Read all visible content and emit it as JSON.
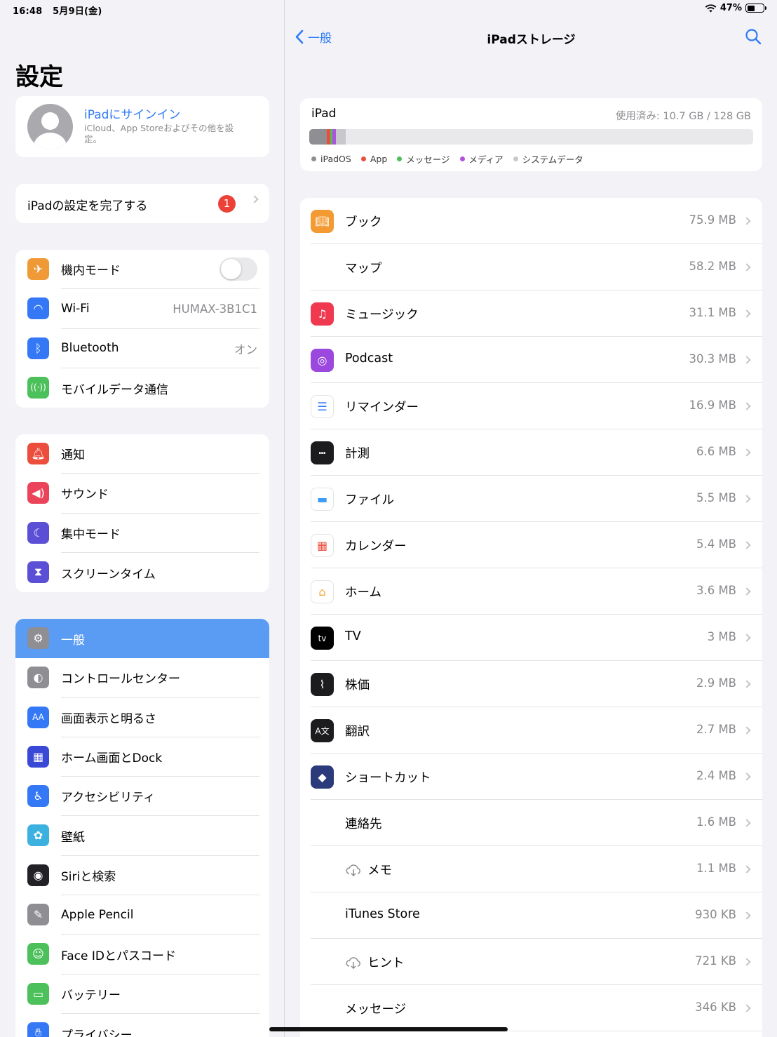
{
  "status": {
    "time": "16:48",
    "date": "5月9日(金)",
    "battery_percent": "47%",
    "battery_level": 0.47
  },
  "left": {
    "title": "設定",
    "profile": {
      "title": "iPadにサインイン",
      "subtitle": "iCloud、App Storeおよびその他を設定。"
    },
    "finish_setup": {
      "label": "iPadの設定を完了する",
      "badge": "1"
    },
    "group1": [
      {
        "label": "機内モード",
        "icon": "airplane-icon",
        "color": "#f09a37",
        "toggle": false
      },
      {
        "label": "Wi-Fi",
        "icon": "wifi-icon",
        "color": "#3478f6",
        "value": "HUMAX-3B1C1"
      },
      {
        "label": "Bluetooth",
        "icon": "bluetooth-icon",
        "color": "#3478f6",
        "value": "オン"
      },
      {
        "label": "モバイルデータ通信",
        "icon": "cellular-icon",
        "color": "#4cc05a"
      }
    ],
    "group2": [
      {
        "label": "通知",
        "icon": "bell-icon",
        "color": "#eb4e3d"
      },
      {
        "label": "サウンド",
        "icon": "speaker-icon",
        "color": "#eb445a"
      },
      {
        "label": "集中モード",
        "icon": "moon-icon",
        "color": "#5b4fd6"
      },
      {
        "label": "スクリーンタイム",
        "icon": "hourglass-icon",
        "color": "#5b4fd6"
      }
    ],
    "group3": [
      {
        "label": "一般",
        "icon": "gear-icon",
        "color": "#8e8e93",
        "selected": true
      },
      {
        "label": "コントロールセンター",
        "icon": "toggles-icon",
        "color": "#8e8e93"
      },
      {
        "label": "画面表示と明るさ",
        "icon": "text-size-icon",
        "color": "#3478f6"
      },
      {
        "label": "ホーム画面とDock",
        "icon": "grid-icon",
        "color": "#3a48d6"
      },
      {
        "label": "アクセシビリティ",
        "icon": "accessibility-icon",
        "color": "#3478f6"
      },
      {
        "label": "壁紙",
        "icon": "flower-icon",
        "color": "#3cb1e0"
      },
      {
        "label": "Siriと検索",
        "icon": "siri-icon",
        "color": "#222226"
      },
      {
        "label": "Apple Pencil",
        "icon": "pencil-icon",
        "color": "#8e8e93"
      },
      {
        "label": "Face IDとパスコード",
        "icon": "faceid-icon",
        "color": "#4cc05a"
      },
      {
        "label": "バッテリー",
        "icon": "battery-icon",
        "color": "#4cc05a"
      },
      {
        "label": "プライバシー",
        "icon": "hand-icon",
        "color": "#3478f6"
      }
    ]
  },
  "right": {
    "back_label": "一般",
    "title": "iPadストレージ",
    "storage": {
      "device": "iPad",
      "used": "使用済み: 10.7 GB / 128 GB",
      "segments": [
        {
          "name": "iPadOS",
          "color": "#8e8e93",
          "fraction": 0.04
        },
        {
          "name": "App",
          "color": "#eb4e3d",
          "fraction": 0.008
        },
        {
          "name": "メッセージ",
          "color": "#4cc05a",
          "fraction": 0.004
        },
        {
          "name": "メディア",
          "color": "#af52de",
          "fraction": 0.008
        },
        {
          "name": "システムデータ",
          "color": "#c7c7cc",
          "fraction": 0.022
        }
      ]
    },
    "apps": [
      {
        "name": "ブック",
        "size": "75.9 MB",
        "icon": "books-icon",
        "color": "#f39a32"
      },
      {
        "name": "マップ",
        "size": "58.2 MB",
        "icon": ""
      },
      {
        "name": "ミュージック",
        "size": "31.1 MB",
        "icon": "music-icon",
        "color": "#f0384f"
      },
      {
        "name": "Podcast",
        "size": "30.3 MB",
        "icon": "podcast-icon",
        "color": "#9a48dd"
      },
      {
        "name": "リマインダー",
        "size": "16.9 MB",
        "icon": "reminders-icon",
        "color": "#ffffff"
      },
      {
        "name": "計測",
        "size": "6.6 MB",
        "icon": "measure-icon",
        "color": "#1c1c1e"
      },
      {
        "name": "ファイル",
        "size": "5.5 MB",
        "icon": "folder-icon",
        "color": "#ffffff"
      },
      {
        "name": "カレンダー",
        "size": "5.4 MB",
        "icon": "calendar-icon",
        "color": "#ffffff"
      },
      {
        "name": "ホーム",
        "size": "3.6 MB",
        "icon": "house-icon",
        "color": "#ffffff"
      },
      {
        "name": "TV",
        "size": "3 MB",
        "icon": "tv-icon",
        "color": "#000000"
      },
      {
        "name": "株価",
        "size": "2.9 MB",
        "icon": "stocks-icon",
        "color": "#1c1c1e"
      },
      {
        "name": "翻訳",
        "size": "2.7 MB",
        "icon": "translate-icon",
        "color": "#1c1c1e"
      },
      {
        "name": "ショートカット",
        "size": "2.4 MB",
        "icon": "shortcuts-icon",
        "color": "#2b3a7a"
      },
      {
        "name": "連絡先",
        "size": "1.6 MB",
        "icon": ""
      },
      {
        "name": "メモ",
        "size": "1.1 MB",
        "icon": "",
        "cloud": true
      },
      {
        "name": "iTunes Store",
        "size": "930 KB",
        "icon": ""
      },
      {
        "name": "ヒント",
        "size": "721 KB",
        "icon": "",
        "cloud": true
      },
      {
        "name": "メッセージ",
        "size": "346 KB",
        "icon": ""
      }
    ]
  }
}
